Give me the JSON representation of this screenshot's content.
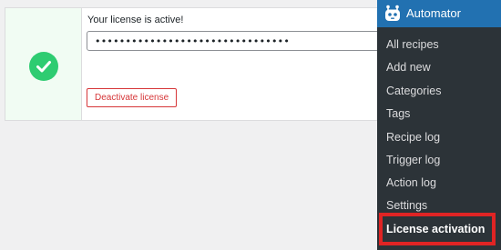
{
  "license": {
    "status_message": "Your license is active!",
    "masked_key": "••••••••••••••••••••••••••••••••",
    "deactivate_label": "Deactivate license",
    "status_icon": "check-circle-icon",
    "status_color": "#2ecc71"
  },
  "admin_menu": {
    "title": "Automator",
    "logo_icon": "automator-robot-icon",
    "header_color": "#2271b1",
    "background_color": "#2c3338",
    "highlight_color": "#e02424",
    "items": [
      {
        "label": "All recipes"
      },
      {
        "label": "Add new"
      },
      {
        "label": "Categories"
      },
      {
        "label": "Tags"
      },
      {
        "label": "Recipe log"
      },
      {
        "label": "Trigger log"
      },
      {
        "label": "Action log"
      },
      {
        "label": "Settings"
      },
      {
        "label": "License activation",
        "current": true
      }
    ]
  }
}
